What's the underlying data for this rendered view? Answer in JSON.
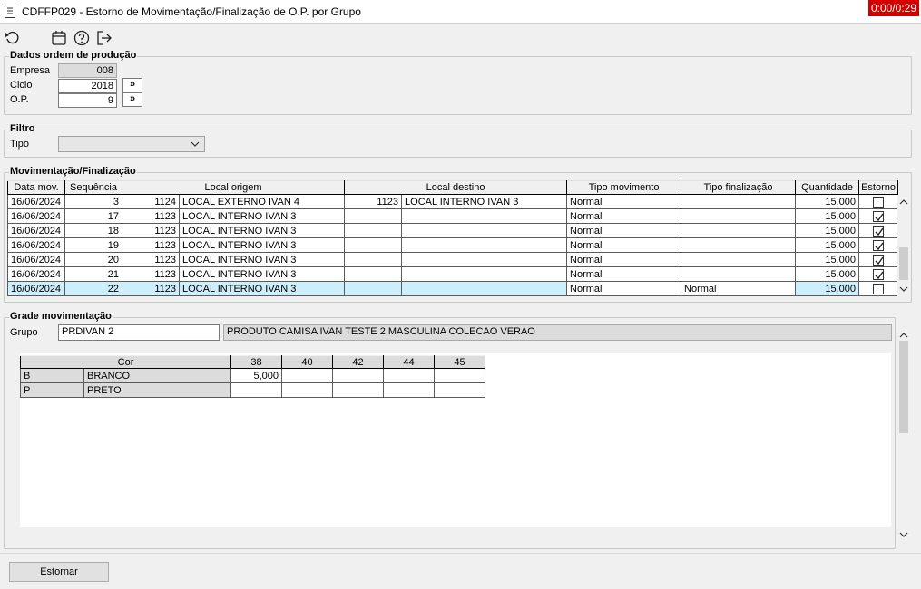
{
  "window": {
    "title": "CDFFP029 - Estorno de Movimentação/Finalização de O.P. por Grupo",
    "timer": "0:00/0:29"
  },
  "toolbar": {
    "icons": [
      "undo-icon",
      "calendar-icon",
      "help-icon",
      "exit-icon"
    ]
  },
  "dados": {
    "title": "Dados ordem de produção",
    "empresa_label": "Empresa",
    "empresa_value": "008",
    "ciclo_label": "Ciclo",
    "ciclo_value": "2018",
    "op_label": "O.P.",
    "op_value": "9",
    "btn_label": "»"
  },
  "filtro": {
    "title": "Filtro",
    "tipo_label": "Tipo",
    "tipo_value": ""
  },
  "mov": {
    "title": "Movimentação/Finalização",
    "headers": [
      "Data mov.",
      "Sequência",
      "Local origem",
      "Local destino",
      "Tipo movimento",
      "Tipo finalização",
      "Quantidade",
      "Estorno"
    ],
    "rows": [
      {
        "data": "16/06/2024",
        "seq": "3",
        "orig_code": "1124",
        "orig_name": "LOCAL EXTERNO IVAN 4",
        "dest_code": "1123",
        "dest_name": "LOCAL INTERNO IVAN 3",
        "tipo_mov": "Normal",
        "tipo_fin": "",
        "qtd": "15,000",
        "estorno": false
      },
      {
        "data": "16/06/2024",
        "seq": "17",
        "orig_code": "1123",
        "orig_name": "LOCAL INTERNO IVAN 3",
        "dest_code": "",
        "dest_name": "",
        "tipo_mov": "Normal",
        "tipo_fin": "",
        "qtd": "15,000",
        "estorno": true
      },
      {
        "data": "16/06/2024",
        "seq": "18",
        "orig_code": "1123",
        "orig_name": "LOCAL INTERNO IVAN 3",
        "dest_code": "",
        "dest_name": "",
        "tipo_mov": "Normal",
        "tipo_fin": "",
        "qtd": "15,000",
        "estorno": true
      },
      {
        "data": "16/06/2024",
        "seq": "19",
        "orig_code": "1123",
        "orig_name": "LOCAL INTERNO IVAN 3",
        "dest_code": "",
        "dest_name": "",
        "tipo_mov": "Normal",
        "tipo_fin": "",
        "qtd": "15,000",
        "estorno": true
      },
      {
        "data": "16/06/2024",
        "seq": "20",
        "orig_code": "1123",
        "orig_name": "LOCAL INTERNO IVAN 3",
        "dest_code": "",
        "dest_name": "",
        "tipo_mov": "Normal",
        "tipo_fin": "",
        "qtd": "15,000",
        "estorno": true
      },
      {
        "data": "16/06/2024",
        "seq": "21",
        "orig_code": "1123",
        "orig_name": "LOCAL INTERNO IVAN 3",
        "dest_code": "",
        "dest_name": "",
        "tipo_mov": "Normal",
        "tipo_fin": "",
        "qtd": "15,000",
        "estorno": true
      },
      {
        "data": "16/06/2024",
        "seq": "22",
        "orig_code": "1123",
        "orig_name": "LOCAL INTERNO IVAN 3",
        "dest_code": "",
        "dest_name": "",
        "tipo_mov": "Normal",
        "tipo_fin": "Normal",
        "qtd": "15,000",
        "estorno": false
      }
    ]
  },
  "grade": {
    "title": "Grade movimentação",
    "grupo_label": "Grupo",
    "grupo_value": "PRDIVAN 2",
    "grupo_desc": "PRODUTO CAMISA IVAN TESTE 2 MASCULINA COLECAO VERAO",
    "cor_header": "Cor",
    "sizes": [
      "38",
      "40",
      "42",
      "44",
      "45"
    ],
    "rows": [
      {
        "code": "B",
        "name": "BRANCO",
        "values": [
          "5,000",
          "",
          "",
          "",
          ""
        ]
      },
      {
        "code": "P",
        "name": "PRETO",
        "values": [
          "",
          "",
          "",
          "",
          ""
        ]
      }
    ]
  },
  "footer": {
    "estornar_label": "Estornar"
  }
}
